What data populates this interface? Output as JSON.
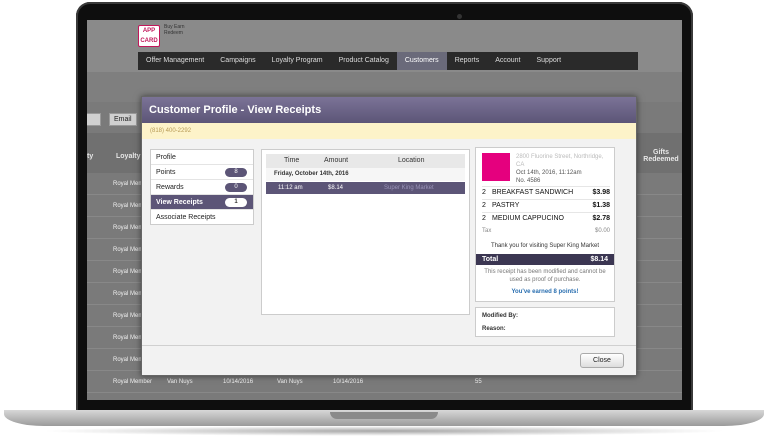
{
  "brand": {
    "logo_text": "APP CARD",
    "tagline": "Buy Earn Redeem"
  },
  "nav": {
    "items": [
      "Offer Management",
      "Campaigns",
      "Loyalty Program",
      "Product Catalog",
      "Customers",
      "Reports",
      "Account",
      "Support"
    ],
    "active": "Customers"
  },
  "filters": {
    "email_label": "Email"
  },
  "bg_table": {
    "headers": {
      "col1": "ty",
      "col2": "Loyalty",
      "col3": "Gifts Redeemed"
    },
    "rows": [
      {
        "c1": "Royal Mem"
      },
      {
        "c1": "Royal Mem"
      },
      {
        "c1": "Royal Mem"
      },
      {
        "c1": "Royal Mem"
      },
      {
        "c1": "Royal Mem"
      },
      {
        "c1": "Royal Mem"
      },
      {
        "c1": "Royal Mem"
      },
      {
        "c1": "Royal Mem"
      },
      {
        "c1": "Royal Mem"
      },
      {
        "c1": "Royal Mem"
      }
    ],
    "last_row": {
      "member": "Royal Member",
      "city": "Van Nuys",
      "date1": "10/14/2016",
      "city2": "Van Nuys",
      "date2": "10/14/2016",
      "points": "55"
    }
  },
  "modal": {
    "title": "Customer Profile - View Receipts",
    "phone": "(818) 400-2292",
    "menu": [
      {
        "label": "Profile",
        "badge": ""
      },
      {
        "label": "Points",
        "badge": "8"
      },
      {
        "label": "Rewards",
        "badge": "0"
      },
      {
        "label": "View Receipts",
        "badge": "1"
      },
      {
        "label": "Associate Receipts",
        "badge": ""
      }
    ],
    "receipts_table": {
      "headers": {
        "time": "Time",
        "amount": "Amount",
        "location": "Location"
      },
      "date": "Friday, October 14th, 2016",
      "row": {
        "time": "11:12 am",
        "amount": "$8.14",
        "location": "Super King Market"
      }
    },
    "receipt": {
      "address_line": "2800 Fluorine Street, Northridge,",
      "state": "CA",
      "datetime": "Oct 14th, 2016, 11:12am",
      "number": "No. 4586",
      "items": [
        {
          "qty": "2",
          "name": "BREAKFAST SANDWICH",
          "price": "$3.98"
        },
        {
          "qty": "2",
          "name": "PASTRY",
          "price": "$1.38"
        },
        {
          "qty": "2",
          "name": "MEDIUM CAPPUCINO",
          "price": "$2.78"
        }
      ],
      "tax_label": "Tax",
      "tax_value": "$0.00",
      "thanks": "Thank you for visiting Super King Market",
      "total_label": "Total",
      "total_value": "$8.14",
      "note": "This receipt has been modified and cannot be used as proof of purchase.",
      "earned": "You've earned 8 points!"
    },
    "modified_by_label": "Modified By:",
    "reason_label": "Reason:",
    "close_label": "Close"
  },
  "colors": {
    "header": "#5c5577",
    "accent": "#e5007e",
    "highlight": "#fdf3c9",
    "link": "#2a6fb0"
  }
}
